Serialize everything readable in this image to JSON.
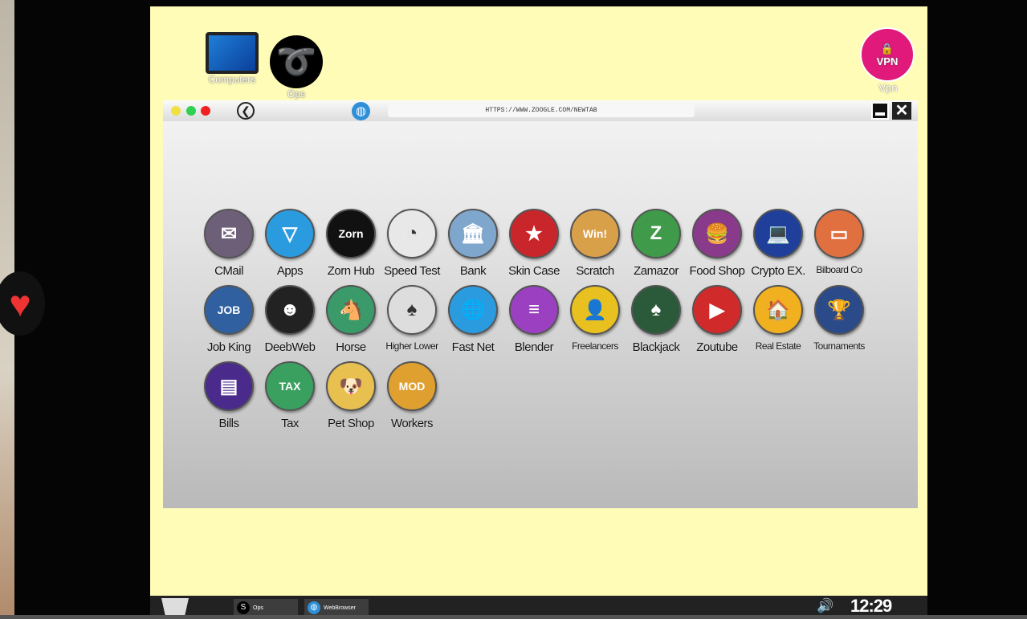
{
  "desktop": {
    "icons": [
      {
        "label": "Computers",
        "icon": "computer-icon"
      },
      {
        "label": "Ops",
        "icon": "ops-icon"
      }
    ],
    "vpn": {
      "label": "Vpn",
      "badge": "VPN",
      "color": "#e0197a"
    }
  },
  "browser": {
    "url": "HTTPS://WWW.ZOOGLE.COM/NEWTAB",
    "apps": [
      {
        "label": "CMail",
        "color": "#6e5f78",
        "glyph": "✉"
      },
      {
        "label": "Apps",
        "color": "#2b9be0",
        "glyph": "▽"
      },
      {
        "label": "Zorn Hub",
        "color": "#111111",
        "glyph": "Zorn"
      },
      {
        "label": "Speed Test",
        "color": "#e8e8e8",
        "glyph": "◔"
      },
      {
        "label": "Bank",
        "color": "#7fa6cc",
        "glyph": "🏛"
      },
      {
        "label": "Skin Case",
        "color": "#c9262c",
        "glyph": "★"
      },
      {
        "label": "Scratch",
        "color": "#d9a04a",
        "glyph": "Win!"
      },
      {
        "label": "Zamazor",
        "color": "#3f9a4a",
        "glyph": "Z"
      },
      {
        "label": "Food Shop",
        "color": "#8a3a8a",
        "glyph": "🍔"
      },
      {
        "label": "Crypto EX.",
        "color": "#1f3f9a",
        "glyph": "💻"
      },
      {
        "label": "Bilboard Co",
        "color": "#e07040",
        "glyph": "▭"
      },
      {
        "label": "Job King",
        "color": "#3060a0",
        "glyph": "JOB"
      },
      {
        "label": "DeebWeb",
        "color": "#222222",
        "glyph": "☻"
      },
      {
        "label": "Horse",
        "color": "#3a9a6a",
        "glyph": "🐴"
      },
      {
        "label": "Higher Lower",
        "color": "#dddddd",
        "glyph": "♠"
      },
      {
        "label": "Fast Net",
        "color": "#2b9be0",
        "glyph": "🌐"
      },
      {
        "label": "Blender",
        "color": "#9a40c0",
        "glyph": "≡"
      },
      {
        "label": "Freelancers",
        "color": "#e8c020",
        "glyph": "👤"
      },
      {
        "label": "Blackjack",
        "color": "#2a5a3a",
        "glyph": "♠"
      },
      {
        "label": "Zoutube",
        "color": "#d02a2a",
        "glyph": "▶"
      },
      {
        "label": "Real Estate",
        "color": "#f0b020",
        "glyph": "🏠"
      },
      {
        "label": "Tournaments",
        "color": "#2a4a8a",
        "glyph": "🏆"
      },
      {
        "label": "Bills",
        "color": "#4a2a8a",
        "glyph": "▤"
      },
      {
        "label": "Tax",
        "color": "#3aa060",
        "glyph": "TAX"
      },
      {
        "label": "Pet Shop",
        "color": "#e8c050",
        "glyph": "🐶"
      },
      {
        "label": "Workers",
        "color": "#e0a030",
        "glyph": "MOD"
      }
    ]
  },
  "taskbar": {
    "items": [
      {
        "label": "Ops",
        "icon": "ops-icon"
      },
      {
        "label": "WebBrowser",
        "icon": "globe-icon"
      }
    ],
    "time": "12:29"
  }
}
